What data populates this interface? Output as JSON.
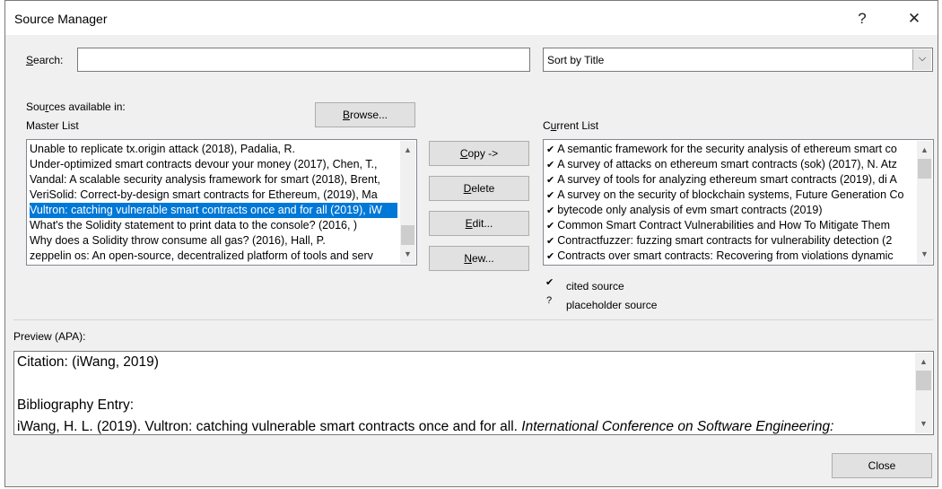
{
  "window": {
    "title": "Source Manager",
    "help_glyph": "?",
    "close_glyph": "✕"
  },
  "search": {
    "label_pre": "",
    "label_ul": "S",
    "label_post": "earch:",
    "value": ""
  },
  "sort": {
    "value": "Sort by Title",
    "arrow": "⌵"
  },
  "sources_label": {
    "pre": "Sou",
    "ul": "r",
    "post": "ces available in:"
  },
  "master_label": "Master List",
  "browse": {
    "pre": "",
    "ul": "B",
    "post": "rowse..."
  },
  "current_label": {
    "pre": "C",
    "ul": "u",
    "post": "rrent List"
  },
  "master_list": [
    "Unable to replicate tx.origin attack (2018), Padalia, R.",
    "Under-optimized smart contracts devour your money (2017), Chen, T.,",
    "Vandal: A scalable security analysis framework for smart (2018), Brent,",
    "VeriSolid: Correct-by-design smart contracts for Ethereum, (2019), Ma",
    "Vultron: catching vulnerable smart contracts once and for all (2019), iW",
    "What's the Solidity statement to print data to the console? (2016, )",
    "Why does a Solidity throw consume all gas? (2016), Hall, P.",
    "zeppelin os: An open-source, decentralized platform of tools and serv"
  ],
  "master_selected_index": 4,
  "buttons": {
    "copy": {
      "pre": "",
      "ul": "C",
      "post": "opy ->"
    },
    "delete": {
      "pre": "",
      "ul": "D",
      "post": "elete"
    },
    "edit": {
      "pre": "",
      "ul": "E",
      "post": "dit..."
    },
    "new": {
      "pre": "",
      "ul": "N",
      "post": "ew..."
    },
    "close": "Close"
  },
  "current_list": [
    "A semantic framework for the security analysis of ethereum smart co",
    "A survey of attacks on ethereum smart contracts (sok) (2017), N. Atz",
    "A survey of tools for analyzing ethereum smart contracts (2019), di A",
    "A survey on the security of blockchain systems, Future Generation Co",
    "bytecode only analysis of evm smart contracts (2019)",
    "Common Smart Contract Vulnerabilities and How To Mitigate Them",
    "Contractfuzzer: fuzzing smart contracts for vulnerability detection (2",
    "Contracts over smart contracts: Recovering from violations dynamic"
  ],
  "check_glyph": "✔",
  "legend": [
    {
      "symbol": "✔",
      "text": "cited source"
    },
    {
      "symbol": "?",
      "text": "placeholder source"
    }
  ],
  "preview": {
    "label": "Preview (APA):",
    "citation": "Citation:  (iWang, 2019)",
    "bib_label": "Bibliography Entry:",
    "bib_text_pre": "iWang, H. L. (2019). Vultron: catching vulnerable smart contracts once and for all. ",
    "bib_text_italic": "International Conference on Software Engineering:"
  },
  "scroll_glyphs": {
    "up": "▲",
    "down": "▼"
  },
  "colors": {
    "selection": "#0078d7",
    "dialog_bg": "#f0f0f0"
  }
}
